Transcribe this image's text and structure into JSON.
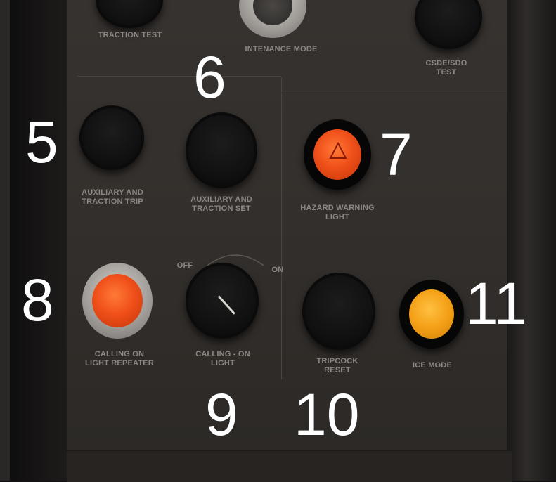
{
  "labels": {
    "traction_test": "TRACTION TEST",
    "maintenance_mode": "INTENANCE MODE",
    "csde_test": "CSDE/SDO\nTEST",
    "aux_traction_trip": "AUXILIARY AND\nTRACTION TRIP",
    "aux_traction_set": "AUXILIARY AND\nTRACTION SET",
    "hazard_warning": "HAZARD WARNING\nLIGHT",
    "calling_on_repeater": "CALLING ON\nLIGHT REPEATER",
    "calling_on_switch": "CALLING - ON\nLIGHT",
    "switch_off": "OFF",
    "switch_on": "ON",
    "tripcock_reset": "TRIPCOCK\nRESET",
    "ice_mode": "ICE MODE"
  },
  "callouts": {
    "n5": "5",
    "n6": "6",
    "n7": "7",
    "n8": "8",
    "n9": "9",
    "n10": "10",
    "n11": "11"
  },
  "colors": {
    "hazard_lens": "#f0501a",
    "repeater_lens": "#f0501a",
    "ice_lens": "#f4a017",
    "panel": "#34302d"
  }
}
